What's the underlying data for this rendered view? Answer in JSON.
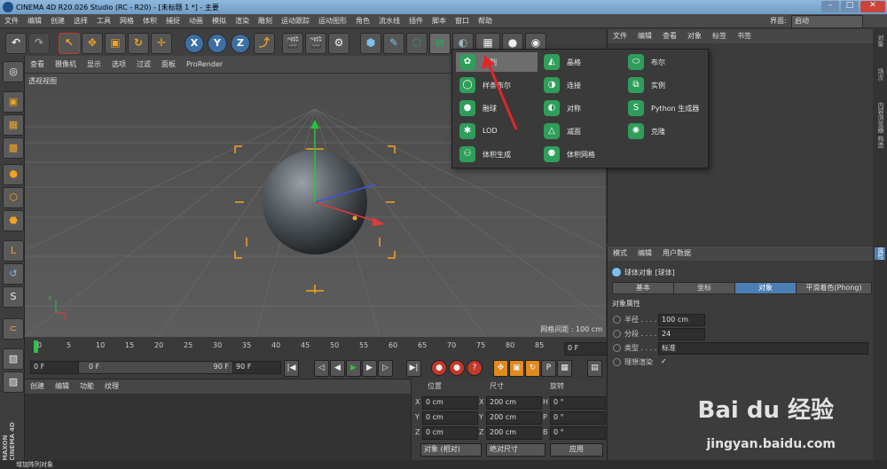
{
  "title": "CINEMA 4D R20.026 Studio (RC - R20) - [未标题 1 *] - 主要",
  "menu": [
    "文件",
    "编辑",
    "创建",
    "选择",
    "工具",
    "网格",
    "体积",
    "捕捉",
    "动画",
    "模拟",
    "渲染",
    "雕刻",
    "运动跟踪",
    "运动图形",
    "角色",
    "流水线",
    "插件",
    "脚本",
    "窗口",
    "帮助"
  ],
  "layout": {
    "label": "界面:",
    "value": "启动"
  },
  "viewport_menu": [
    "查看",
    "摄像机",
    "显示",
    "选项",
    "过滤",
    "面板",
    "ProRender"
  ],
  "viewport": {
    "name": "透视视图",
    "grid_spacing": "网格间距 : 100 cm"
  },
  "popup": {
    "items": [
      {
        "label": "阵列"
      },
      {
        "label": "晶格"
      },
      {
        "label": "布尔"
      },
      {
        "label": "样条布尔"
      },
      {
        "label": "连接"
      },
      {
        "label": "实例"
      },
      {
        "label": "融球"
      },
      {
        "label": "对称"
      },
      {
        "label": "Python 生成器"
      },
      {
        "label": "LOD"
      },
      {
        "label": "减面"
      },
      {
        "label": "克隆"
      },
      {
        "label": "体积生成"
      },
      {
        "label": "体积网格"
      }
    ]
  },
  "timeline": {
    "ticks": [
      "0",
      "5",
      "10",
      "15",
      "20",
      "25",
      "30",
      "35",
      "40",
      "45",
      "50",
      "55",
      "60",
      "65",
      "70",
      "75",
      "80",
      "85",
      "90"
    ],
    "current": "0 F"
  },
  "transport": {
    "start": "0 F",
    "range_start": "0 F",
    "range_end": "90 F",
    "end": "90 F"
  },
  "material_menu": [
    "创建",
    "编辑",
    "功能",
    "纹理"
  ],
  "coords": {
    "headers": [
      "位置",
      "尺寸",
      "旋转"
    ],
    "rows": [
      {
        "axis": "X",
        "pos": "0 cm",
        "size_axis": "X",
        "size": "200 cm",
        "rot_axis": "H",
        "rot": "0 °"
      },
      {
        "axis": "Y",
        "pos": "0 cm",
        "size_axis": "Y",
        "size": "200 cm",
        "rot_axis": "P",
        "rot": "0 °"
      },
      {
        "axis": "Z",
        "pos": "0 cm",
        "size_axis": "Z",
        "size": "200 cm",
        "rot_axis": "B",
        "rot": "0 °"
      }
    ],
    "mode": "对象 (相对)",
    "size_mode": "绝对尺寸",
    "apply": "应用"
  },
  "objects_menu": [
    "文件",
    "编辑",
    "查看",
    "对象",
    "标签",
    "书签"
  ],
  "attr": {
    "menu": [
      "模式",
      "编辑",
      "用户数据"
    ],
    "object_title": "球体对象 [球体]",
    "tabs": [
      "基本",
      "坐标",
      "对象",
      "平滑着色(Phong)"
    ],
    "section": "对象属性",
    "props": [
      {
        "label": "半径 . . . .",
        "value": "100 cm"
      },
      {
        "label": "分段 . . . .",
        "value": "24"
      },
      {
        "label": "类型 . . . .",
        "value": "标准"
      },
      {
        "label": "理想渲染",
        "value": "✓"
      }
    ]
  },
  "vtabs": [
    "对象",
    "场次",
    "内容浏览器",
    "构造"
  ],
  "vtabs_bottom": [
    "属性"
  ],
  "status": "增加阵列对象",
  "brand": "MAXON CINEMA 4D",
  "watermark": {
    "main": "Bai du 经验",
    "sub": "jingyan.baidu.com"
  },
  "colors": {
    "accent": "#4b7fb3",
    "generator_green": "#2f9e5a",
    "tool_orange": "#f3a321"
  }
}
